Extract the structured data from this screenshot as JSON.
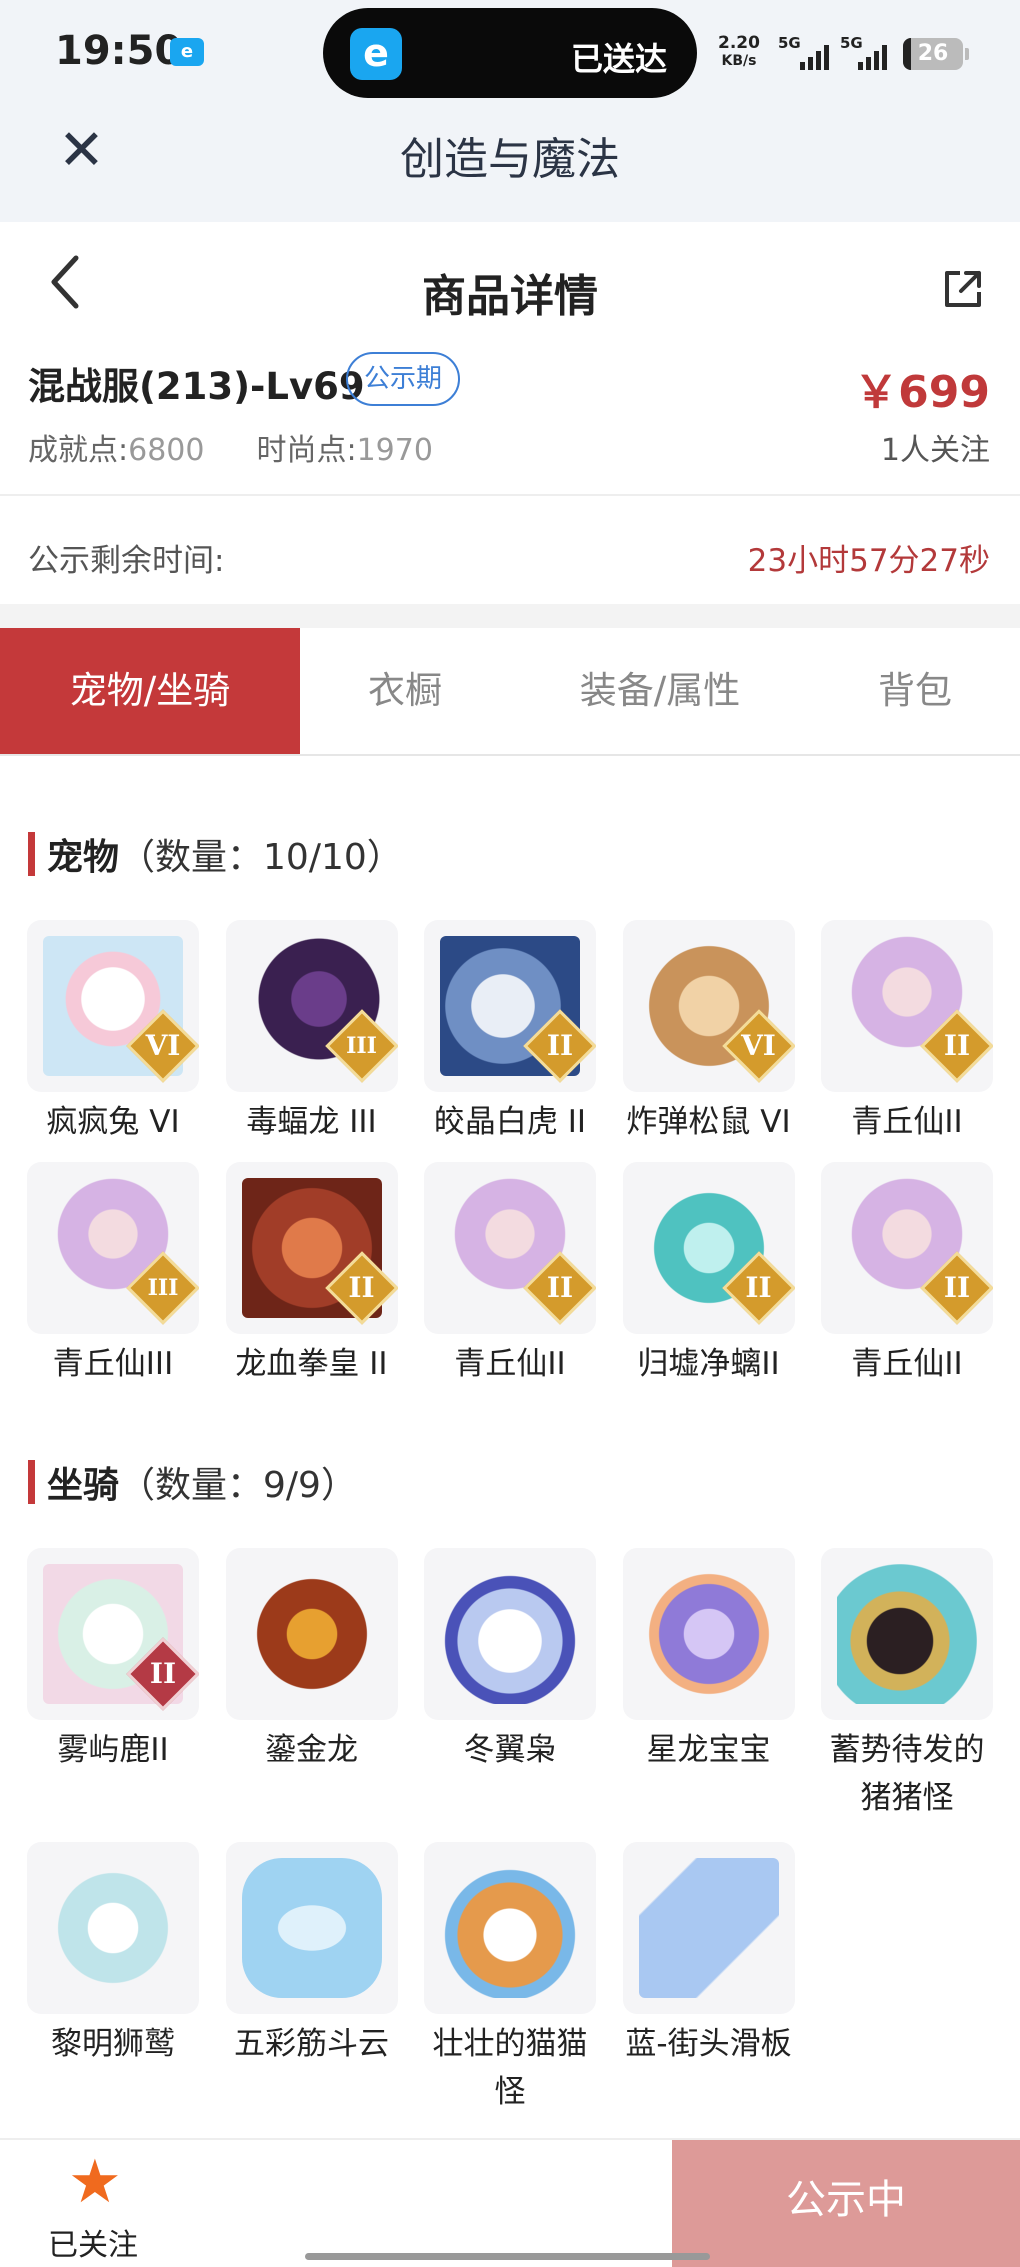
{
  "status_bar": {
    "time": "19:50",
    "app_icon_text": "e",
    "island_icon_text": "e",
    "island_text": "已送达",
    "net_speed_value": "2.20",
    "net_speed_unit": "KB/s",
    "signal1": "5G",
    "signal2": "5G",
    "battery": "26"
  },
  "app_header": {
    "close_icon": "close-icon",
    "title": "创造与魔法"
  },
  "page_header": {
    "title": "商品详情",
    "back_icon": "chevron-left-icon",
    "share_icon": "share-icon"
  },
  "listing": {
    "server": "混战服(213)-Lv69",
    "badge": "公示期",
    "price": "￥699",
    "achievement_label": "成就点:",
    "achievement_value": "6800",
    "fashion_label": "时尚点:",
    "fashion_value": "1970",
    "followers": "1人关注",
    "remaining_label": "公示剩余时间:",
    "remaining_value": "23小时57分27秒"
  },
  "tabs": [
    {
      "label": "宠物/坐骑",
      "active": true
    },
    {
      "label": "衣橱",
      "active": false
    },
    {
      "label": "装备/属性",
      "active": false
    },
    {
      "label": "背包",
      "active": false
    }
  ],
  "pets": {
    "title": "宠物",
    "count": "（数量：10/10）",
    "items": [
      {
        "name": "疯疯兔 VI",
        "rank": "VI",
        "icon": "rabbit-icon"
      },
      {
        "name": "毒蝠龙 III",
        "rank": "III",
        "icon": "dragon-icon"
      },
      {
        "name": "皎晶白虎 II",
        "rank": "II",
        "icon": "tiger-icon"
      },
      {
        "name": "炸弹松鼠 VI",
        "rank": "VI",
        "icon": "squirrel-icon"
      },
      {
        "name": "青丘仙II",
        "rank": "II",
        "icon": "fox-fairy-icon"
      },
      {
        "name": "青丘仙III",
        "rank": "III",
        "icon": "fox-fairy-icon"
      },
      {
        "name": "龙血拳皇 II",
        "rank": "II",
        "icon": "ram-beast-icon"
      },
      {
        "name": "青丘仙II",
        "rank": "II",
        "icon": "fox-fairy-icon"
      },
      {
        "name": "归墟净螭II",
        "rank": "II",
        "icon": "water-dragon-icon"
      },
      {
        "name": "青丘仙II",
        "rank": "II",
        "icon": "fox-fairy-icon"
      }
    ]
  },
  "mounts": {
    "title": "坐骑",
    "count": "（数量：9/9）",
    "items": [
      {
        "name": "雾屿鹿II",
        "rank": "II",
        "icon": "deer-icon"
      },
      {
        "name": "鎏金龙",
        "rank": "",
        "icon": "golden-dragon-icon"
      },
      {
        "name": "冬翼枭",
        "rank": "",
        "icon": "owl-icon"
      },
      {
        "name": "星龙宝宝",
        "rank": "",
        "icon": "baby-dragon-icon"
      },
      {
        "name": "蓄势待发的猪猪怪",
        "rank": "",
        "icon": "pig-icon"
      },
      {
        "name": "黎明狮鹫",
        "rank": "",
        "icon": "griffin-icon"
      },
      {
        "name": "五彩筋斗云",
        "rank": "",
        "icon": "cloud-icon"
      },
      {
        "name": "壮壮的猫猫怪",
        "rank": "",
        "icon": "cat-icon"
      },
      {
        "name": "蓝-街头滑板",
        "rank": "",
        "icon": "skateboard-icon"
      }
    ]
  },
  "bottom_bar": {
    "follow_label": "已关注",
    "follow_icon": "star-icon",
    "cta": "公示中"
  },
  "colors": {
    "accent": "#c4393a",
    "price": "#c0393a",
    "badge_blue": "#3d7fd6",
    "cta_bg": "#dd9a98",
    "star": "#f06a1e"
  }
}
